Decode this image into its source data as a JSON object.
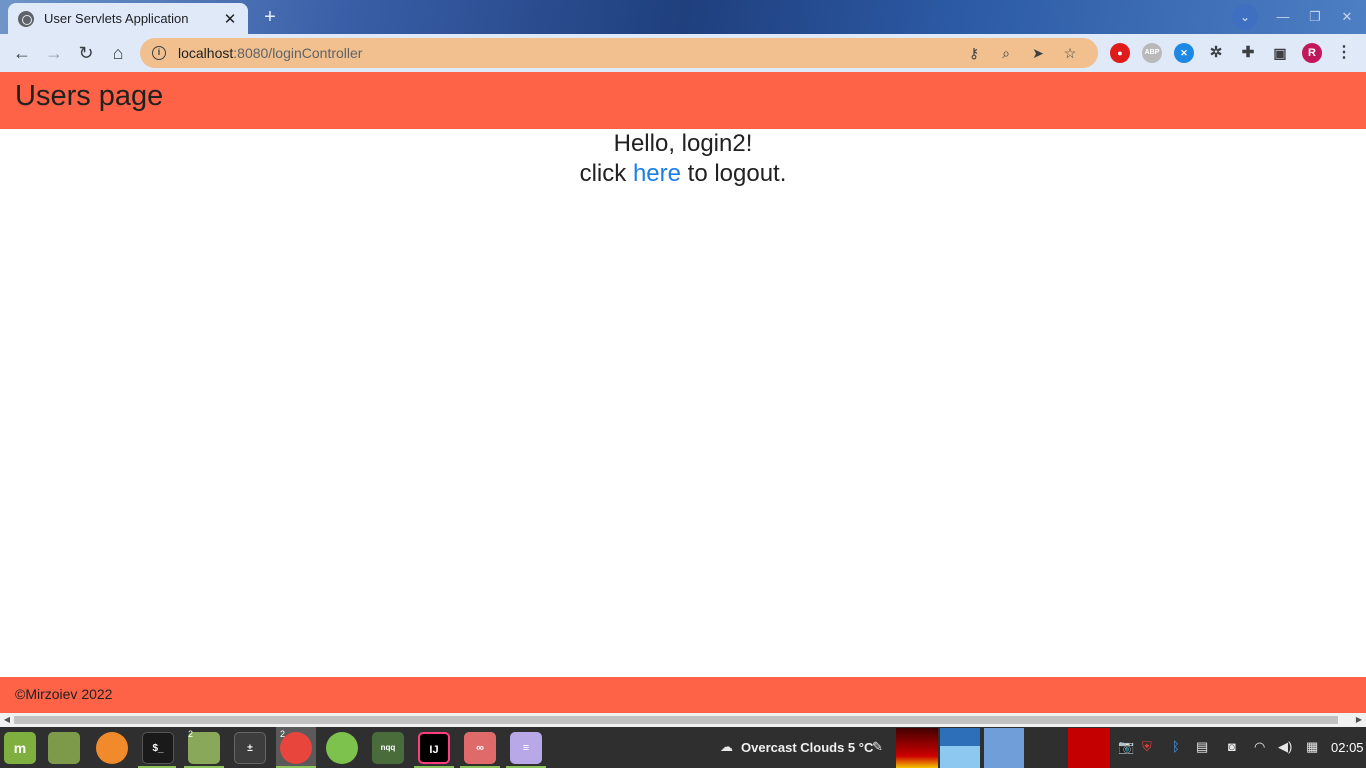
{
  "browser": {
    "tab_title": "User Servlets Application",
    "tab_close": "✕",
    "new_tab": "+",
    "url_host": "localhost",
    "url_rest": ":8080/loginController",
    "profile_initial": "R"
  },
  "page": {
    "header_title": "Users page",
    "greeting": "Hello, login2!",
    "logout_prefix": "click ",
    "logout_link": "here",
    "logout_suffix": " to logout.",
    "footer_text": "©Mirzoiev 2022"
  },
  "taskbar": {
    "weather": "Overcast Clouds 5 °C",
    "clock": "02:05",
    "badge_files": "2",
    "badge_chrome": "2"
  },
  "colors": {
    "header_bg": "#ff6347",
    "link": "#1a7fe6",
    "omnibox": "#f1c08e"
  }
}
